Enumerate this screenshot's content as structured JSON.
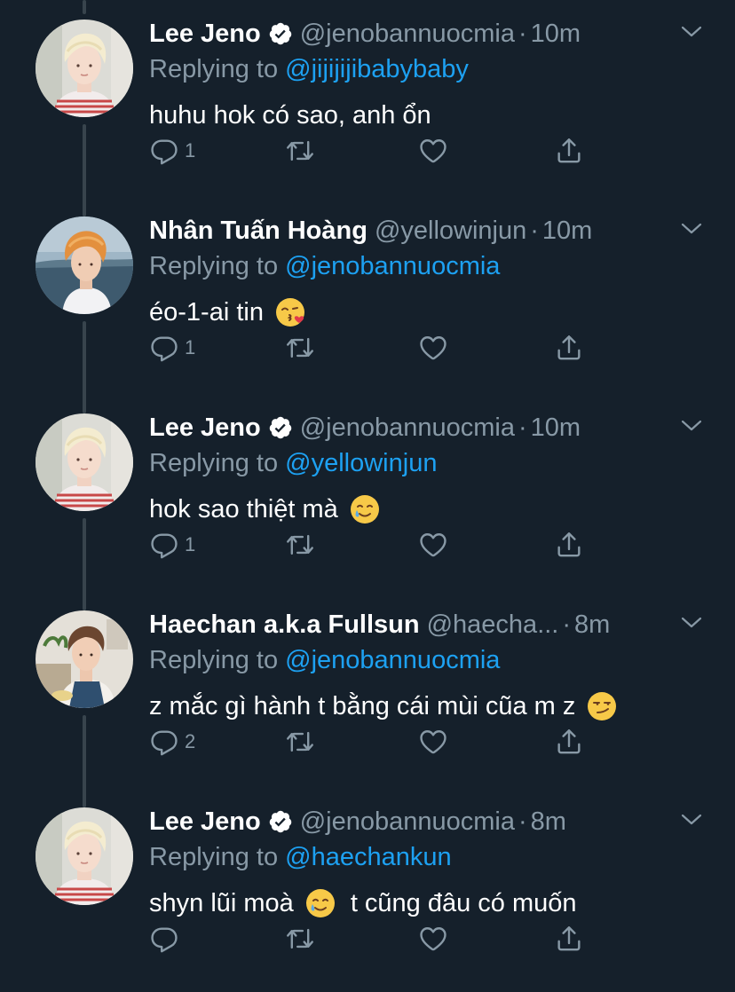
{
  "tweets": [
    {
      "name": "Lee Jeno",
      "verified": true,
      "handle": "@jenobannuocmia",
      "separator": "·",
      "time": "10m",
      "replying_prefix": "Replying to",
      "replying_to": "@jijijijibabybaby",
      "text": "huhu hok có sao, anh ổn",
      "emoji": "",
      "text_after": "",
      "reply_count": "1",
      "avatar": "blonde-striped-shirt"
    },
    {
      "name": "Nhân Tuấn Hoàng",
      "verified": false,
      "handle": "@yellowinjun",
      "separator": "·",
      "time": "10m",
      "replying_prefix": "Replying to",
      "replying_to": "@jenobannuocmia",
      "text": "éo-1-ai tin",
      "emoji": "kissing-heart",
      "text_after": "",
      "reply_count": "1",
      "avatar": "orange-hair-sea"
    },
    {
      "name": "Lee Jeno",
      "verified": true,
      "handle": "@jenobannuocmia",
      "separator": "·",
      "time": "10m",
      "replying_prefix": "Replying to",
      "replying_to": "@yellowinjun",
      "text": "hok sao thiệt mà",
      "emoji": "smiling-tear",
      "text_after": "",
      "reply_count": "1",
      "avatar": "blonde-striped-shirt"
    },
    {
      "name": "Haechan a.k.a Fullsun",
      "verified": false,
      "handle": "@haecha...",
      "separator": "·",
      "time": "8m",
      "replying_prefix": "Replying to",
      "replying_to": "@jenobannuocmia",
      "text": "z mắc gì hành t bằng cái mùi cũa m z",
      "emoji": "smirk",
      "text_after": "",
      "reply_count": "2",
      "avatar": "apron-kitchen"
    },
    {
      "name": "Lee Jeno",
      "verified": true,
      "handle": "@jenobannuocmia",
      "separator": "·",
      "time": "8m",
      "replying_prefix": "Replying to",
      "replying_to": "@haechankun",
      "text": "shyn lũi moà",
      "emoji": "smiling-tear",
      "text_after": "t cũng đâu có muốn",
      "reply_count": "",
      "avatar": "blonde-striped-shirt"
    }
  ],
  "colors": {
    "background": "#15202b",
    "secondary_text": "#8899a6",
    "mention": "#1da1f2",
    "thread_line": "#38444d"
  },
  "icons": {
    "reply": "speech-bubble-icon",
    "retweet": "retweet-arrows-icon",
    "like": "heart-outline-icon",
    "share": "share-upload-icon",
    "menu": "chevron-down-icon",
    "verified": "verified-badge-icon"
  }
}
